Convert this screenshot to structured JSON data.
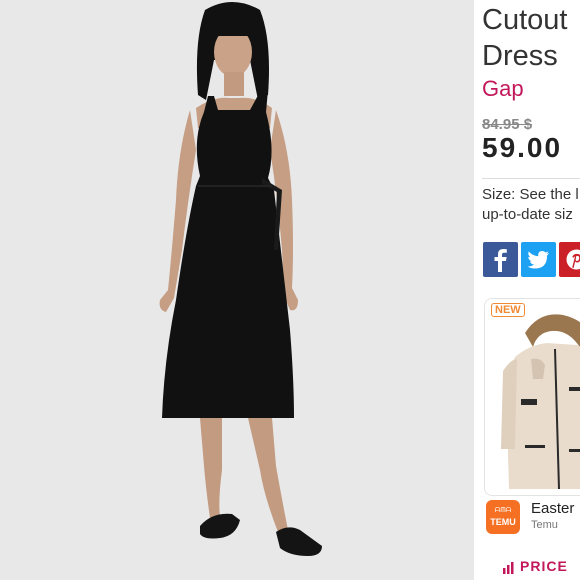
{
  "product": {
    "title_line1": "Cutout",
    "title_line2": "Dress",
    "brand": "Gap",
    "original_price": "84.95 $",
    "price": "59.00",
    "size_line1": "Size: See the l",
    "size_line2": "up-to-date siz"
  },
  "share": {
    "icons": [
      "facebook-icon",
      "twitter-icon",
      "pinterest-icon"
    ],
    "colors": {
      "facebook": "#3b5998",
      "twitter": "#1da1f2",
      "pinterest": "#cb2027"
    }
  },
  "ad": {
    "badge": "NEW",
    "logo_top": "ᗩᗰᗩ",
    "logo_text": "TEMU",
    "title": "Easter",
    "subtitle": "Temu"
  },
  "footer": {
    "price_label": "PRICE"
  },
  "colors": {
    "brand_accent": "#c2185b",
    "temu_orange": "#f57022"
  }
}
